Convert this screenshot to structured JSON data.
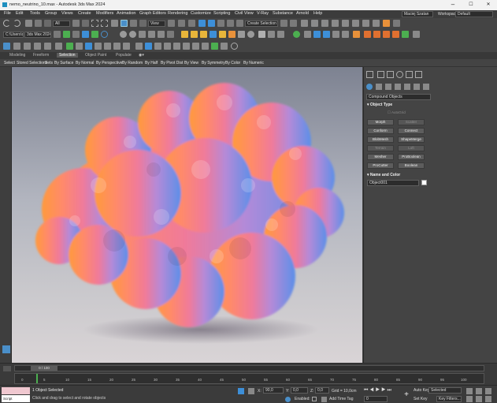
{
  "titlebar": {
    "title": "nemo_neutrino_10.max - Autodesk 3ds Max 2024",
    "min": "–",
    "max": "☐",
    "close": "✕"
  },
  "menu": [
    "File",
    "Edit",
    "Tools",
    "Group",
    "Views",
    "Create",
    "Modifiers",
    "Animation",
    "Graph Editors",
    "Rendering",
    "Customize",
    "Scripting",
    "Civil View",
    "V-Ray",
    "Substance",
    "Arnold",
    "Help"
  ],
  "user": {
    "name": "Maciej Szatan",
    "workspace_label": "Workspaces:",
    "workspace": "Default"
  },
  "toolbar": {
    "filter": "All",
    "view": "View",
    "selection_set": "Create Selection Se",
    "project": "C:\\Users\\szat",
    "app": "3ds Max 2024"
  },
  "ribbon_tabs": [
    "Modeling",
    "Freeform",
    "Selection",
    "Object Paint",
    "Populate"
  ],
  "ribbon_active": "Selection",
  "ribbon_items": [
    "Select",
    "Stored Selections",
    "Sets",
    "By Surface",
    "By Normal",
    "By Perspective",
    "By Random",
    "By Half",
    "By Pivot Dist",
    "By View",
    "By Symmetry",
    "By Color",
    "By Numeric"
  ],
  "cmd": {
    "category": "Compound Objects",
    "object_type": "Object Type",
    "autogrid": "AutoGrid",
    "buttons": [
      {
        "label": "Morph",
        "enabled": true
      },
      {
        "label": "Scatter",
        "enabled": false
      },
      {
        "label": "Conform",
        "enabled": true
      },
      {
        "label": "Connect",
        "enabled": true
      },
      {
        "label": "BlobMesh",
        "enabled": true
      },
      {
        "label": "ShapeMerge",
        "enabled": true
      },
      {
        "label": "Terrain",
        "enabled": false
      },
      {
        "label": "Loft",
        "enabled": false
      },
      {
        "label": "Mesher",
        "enabled": true
      },
      {
        "label": "ProBoolean",
        "enabled": true
      },
      {
        "label": "ProCutter",
        "enabled": true
      },
      {
        "label": "Boolean",
        "enabled": true
      }
    ],
    "name_color": "Name and Color",
    "object_name": "Object001"
  },
  "timeline": {
    "frame": "0 / 100",
    "ticks": [
      "0",
      "5",
      "10",
      "15",
      "20",
      "25",
      "30",
      "35",
      "40",
      "45",
      "50",
      "55",
      "60",
      "65",
      "70",
      "75",
      "80",
      "85",
      "90",
      "95",
      "100"
    ]
  },
  "status": {
    "objects": "1 Object Selected",
    "prompt": "Click and drag to select and rotate objects",
    "script": "Script",
    "x": "90,0",
    "y": "0,0",
    "z": "0,0",
    "grid": "Grid = 10,0cm",
    "enabled": "Enabled:",
    "add_time_tag": "Add Time Tag",
    "auto_key": "Auto Key",
    "set_key": "Set Key",
    "selected": "Selected",
    "key_filters": "Key Filters...",
    "frame_field": "0"
  },
  "colors": {
    "accent": "#4a8fc9",
    "blue_icon": "#3d8fd8",
    "orange_icon": "#e8913a",
    "green_icon": "#4caf50"
  }
}
